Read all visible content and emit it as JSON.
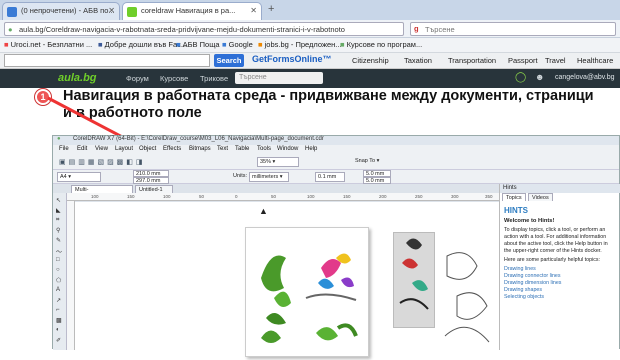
{
  "browser": {
    "tabs": [
      {
        "label": "(0 непрочетени) - АБВ по..."
      },
      {
        "label": "coreldraw Навигация в ра..."
      }
    ],
    "url": "aula.bg/Coreldraw-navigacia-v-rabotnata-sreda-pridvijvane-mejdu-dokumenti-stranici-i-v-rabotnoto",
    "search_placeholder": "Търсене"
  },
  "bookmarks": [
    {
      "label": "Uroci.net - Безплатни ..."
    },
    {
      "label": "Добре дошли във Fac..."
    },
    {
      "label": "АБВ Поща"
    },
    {
      "label": "Google"
    },
    {
      "label": "jobs.bg - Предложен..."
    },
    {
      "label": "Курсове по програм..."
    }
  ],
  "toolbar2": {
    "search_button": "Search",
    "items": [
      "GetFormsOnline™",
      "Citizenship",
      "Taxation",
      "Transportation",
      "Passport",
      "Travel",
      "Healthcare"
    ]
  },
  "site": {
    "logo": "aula.bg",
    "nav": [
      "Форум",
      "Курсове",
      "Трикове"
    ],
    "search_placeholder": "Търсене",
    "user": "cangelova@abv.bg"
  },
  "page": {
    "title_line1": "Навигация в работната среда - придвижване между документи, страници",
    "title_line2": "и в работното поле",
    "marker": "1"
  },
  "corel": {
    "window_title": "CorelDRAW X7 (64-Bit) - E:\\CorelDraw_course\\M03_L06_Navigacia\\Multi-page_document.cdr",
    "menu": [
      "File",
      "Edit",
      "View",
      "Layout",
      "Object",
      "Effects",
      "Bitmaps",
      "Text",
      "Table",
      "Tools",
      "Window",
      "Help"
    ],
    "zoom": "35%",
    "snap_to": "Snap To",
    "page_size": "A4",
    "width": "210.0 mm",
    "height": "297.0 mm",
    "units_label": "Units:",
    "units": "millimeters",
    "nudge": "0.1 mm",
    "dup_x": "5.0 mm",
    "dup_y": "5.0 mm",
    "doc_tabs": [
      "Multi-page_document...",
      "Untitled-1"
    ],
    "ruler_ticks": [
      "100",
      "150",
      "100",
      "50",
      "0",
      "50",
      "100",
      "150",
      "200",
      "250",
      "300",
      "350"
    ],
    "hints": {
      "panel": "Hints",
      "tabs": [
        "Topics",
        "Videos"
      ],
      "heading": "HINTS",
      "welcome": "Welcome to Hints!",
      "intro": "To display topics, click a tool, or perform an action with a tool. For additional information about the active tool, click the Help button in the upper-right corner of the Hints docker.",
      "helpful": "Here are some particularly helpful topics:",
      "links": [
        "Drawing lines",
        "Drawing connector lines",
        "Drawing dimension lines",
        "Drawing shapes",
        "Selecting objects"
      ]
    }
  }
}
